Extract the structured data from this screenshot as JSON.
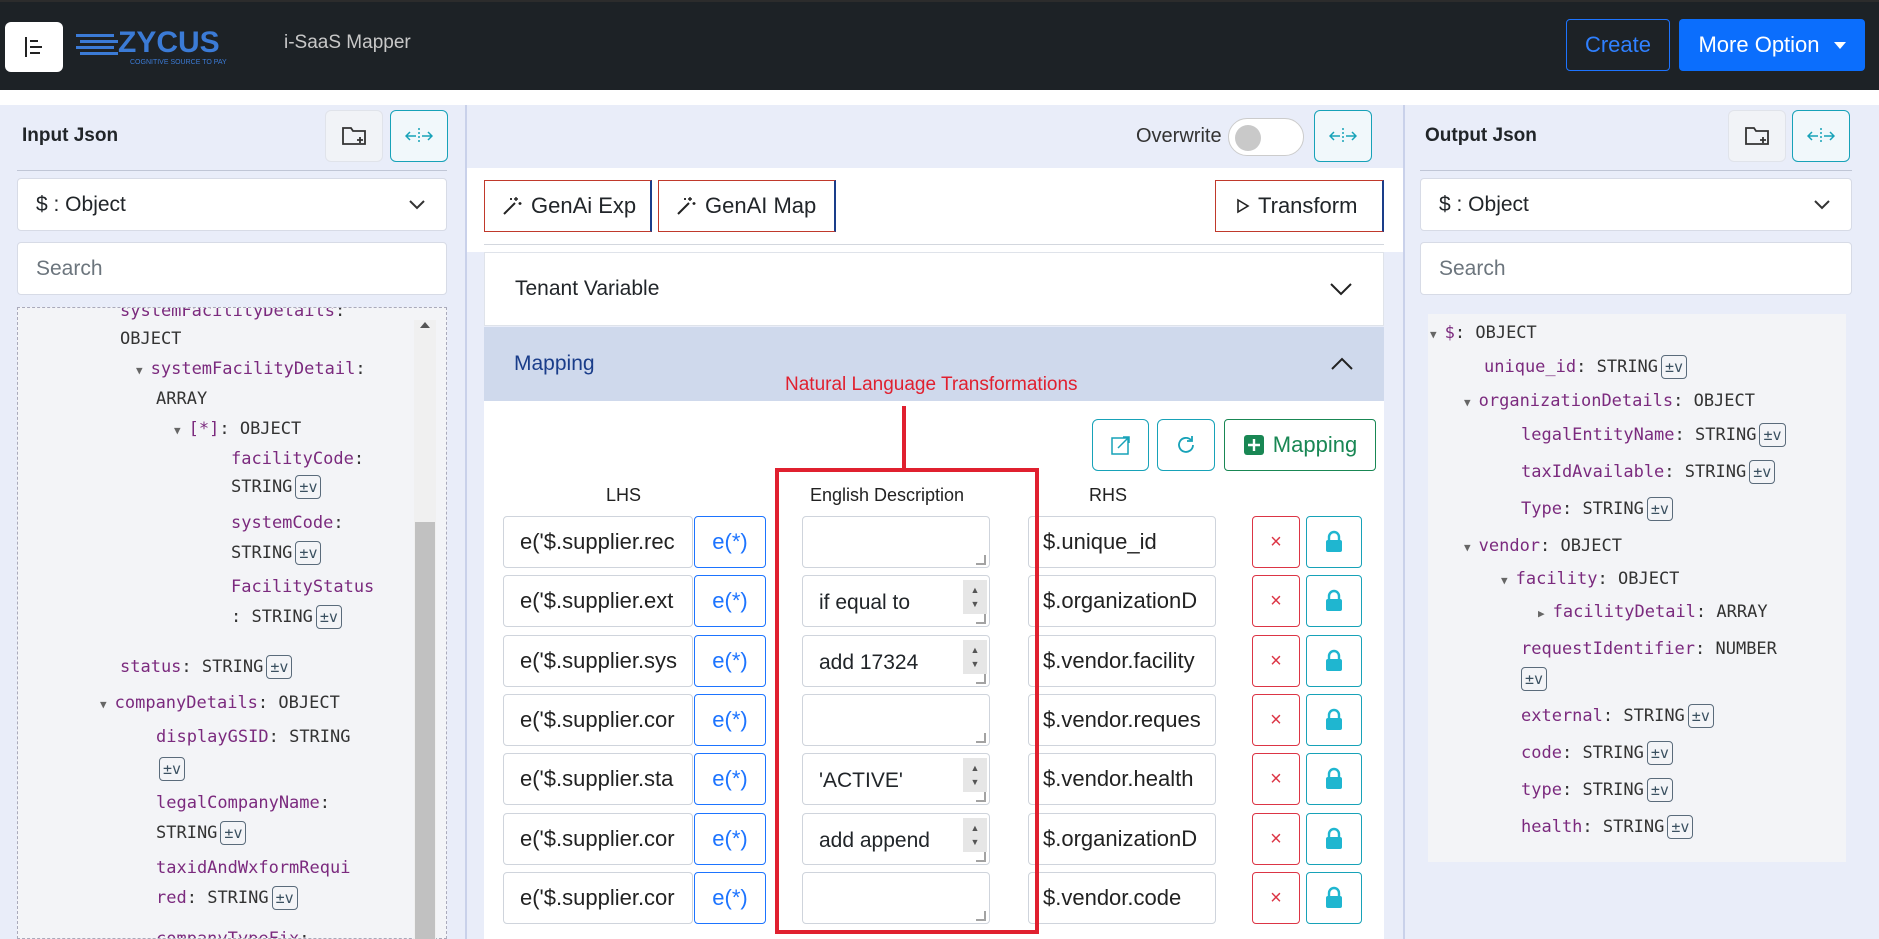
{
  "header": {
    "logo_text": "ZYCUS",
    "logo_tagline": "COGNITIVE SOURCE TO PAY",
    "app_name": "i-SaaS Mapper",
    "create_label": "Create",
    "more_label": "More Option"
  },
  "input_panel": {
    "title": "Input Json",
    "select_value": "$ : Object",
    "search_placeholder": "Search",
    "tree": [
      {
        "key": "systemFacilityDetails",
        "type": "OBJECT"
      },
      {
        "key": "systemFacilityDetail",
        "type": "ARRAY"
      },
      {
        "key": "[*]",
        "type": "OBJECT"
      },
      {
        "key": "facilityCode",
        "type": "STRING",
        "tag": "±v"
      },
      {
        "key": "systemCode",
        "type": "STRING",
        "tag": "±v"
      },
      {
        "key": "FacilityStatus",
        "type": "STRING",
        "tag": "±v"
      },
      {
        "key": "status",
        "type": "STRING",
        "tag": "±v"
      },
      {
        "key": "companyDetails",
        "type": "OBJECT"
      },
      {
        "key": "displayGSID",
        "type": "STRING",
        "tag": "±v"
      },
      {
        "key": "legalCompanyName",
        "type": "STRING",
        "tag": "±v"
      },
      {
        "key": "taxidAndWxformRequired",
        "type": "STRING",
        "tag": "±v"
      },
      {
        "key": "companyTypeFix",
        "type": ""
      }
    ]
  },
  "middle": {
    "overwrite_label": "Overwrite",
    "genai_exp_label": "GenAi Exp",
    "genai_map_label": "GenAI Map",
    "transform_label": "Transform",
    "tenant_variable_label": "Tenant Variable",
    "mapping_label": "Mapping",
    "annotation": "Natural Language Transformations",
    "add_mapping_label": "Mapping",
    "col_lhs": "LHS",
    "col_desc": "English Description",
    "col_rhs": "RHS",
    "rows": [
      {
        "lhs": "e('$.supplier.rec",
        "ebtn": "e(*)",
        "desc": "",
        "rhs": "$.unique_id"
      },
      {
        "lhs": "e('$.supplier.ext",
        "ebtn": "e(*)",
        "desc": "if equal to",
        "rhs": "$.organizationD"
      },
      {
        "lhs": "e('$.supplier.sys",
        "ebtn": "e(*)",
        "desc": "add 17324",
        "rhs": "$.vendor.facility"
      },
      {
        "lhs": "e('$.supplier.cor",
        "ebtn": "e(*)",
        "desc": "",
        "rhs": "$.vendor.reques"
      },
      {
        "lhs": "e('$.supplier.sta",
        "ebtn": "e(*)",
        "desc": "'ACTIVE'",
        "rhs": "$.vendor.health"
      },
      {
        "lhs": "e('$.supplier.cor",
        "ebtn": "e(*)",
        "desc": "add append",
        "rhs": "$.organizationD"
      },
      {
        "lhs": "e('$.supplier.cor",
        "ebtn": "e(*)",
        "desc": "",
        "rhs": "$.vendor.code"
      }
    ],
    "delete_symbol": "×"
  },
  "output_panel": {
    "title": "Output Json",
    "select_value": "$ : Object",
    "search_placeholder": "Search",
    "tree": [
      {
        "key": "$",
        "type": "OBJECT"
      },
      {
        "key": "unique_id",
        "type": "STRING",
        "tag": "±v"
      },
      {
        "key": "organizationDetails",
        "type": "OBJECT"
      },
      {
        "key": "legalEntityName",
        "type": "STRING",
        "tag": "±v"
      },
      {
        "key": "taxIdAvailable",
        "type": "STRING",
        "tag": "±v"
      },
      {
        "key": "Type",
        "type": "STRING",
        "tag": "±v"
      },
      {
        "key": "vendor",
        "type": "OBJECT"
      },
      {
        "key": "facility",
        "type": "OBJECT"
      },
      {
        "key": "facilityDetail",
        "type": "ARRAY"
      },
      {
        "key": "requestIdentifier",
        "type": "NUMBER",
        "tag": "±v"
      },
      {
        "key": "external",
        "type": "STRING",
        "tag": "±v"
      },
      {
        "key": "code",
        "type": "STRING",
        "tag": "±v"
      },
      {
        "key": "type",
        "type": "STRING",
        "tag": "±v"
      },
      {
        "key": "health",
        "type": "STRING",
        "tag": "±v"
      }
    ]
  },
  "colors": {
    "accent_blue": "#0b6efd",
    "teal": "#17a2b8",
    "danger": "#dc3545",
    "annotation_red": "#e0202f",
    "success": "#198754"
  }
}
